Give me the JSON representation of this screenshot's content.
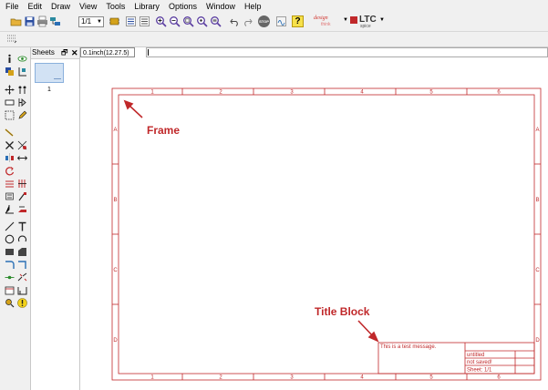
{
  "menu": [
    "File",
    "Edit",
    "Draw",
    "View",
    "Tools",
    "Library",
    "Options",
    "Window",
    "Help"
  ],
  "toolbar": {
    "zoom_ratio": "1/1",
    "help_glyph": "?",
    "brand1_line1": "design",
    "brand1_line2": "think",
    "brand2_main": "LTC",
    "brand2_sub": "spice",
    "stop_label": "STOP"
  },
  "sheets_panel": {
    "title": "Sheets",
    "sheet_number": "1"
  },
  "coord_readout": "0.1inch(12.27.5)",
  "frame": {
    "col_labels": [
      "1",
      "2",
      "3",
      "4",
      "5",
      "6"
    ],
    "row_labels": [
      "A",
      "B",
      "C",
      "D"
    ],
    "message": "This is a test message.",
    "title_name": "untitled",
    "title_saved": "not saved!",
    "title_sheet": "Sheet: 1/1"
  },
  "annotations": {
    "frame": "Frame",
    "title_block": "Title Block"
  },
  "colors": {
    "frame_red": "#c0282a",
    "annotation_red": "#c0282a"
  }
}
